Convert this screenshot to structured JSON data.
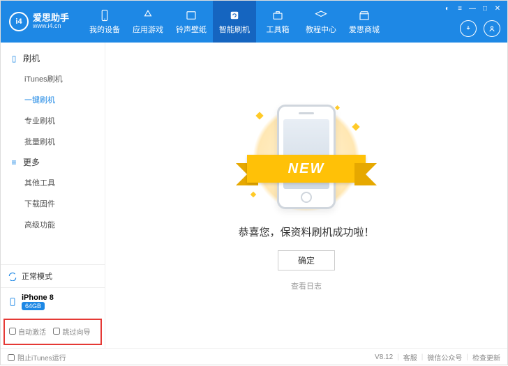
{
  "logo": {
    "badge": "i4",
    "title": "爱思助手",
    "sub": "www.i4.cn"
  },
  "nav": {
    "items": [
      {
        "label": "我的设备"
      },
      {
        "label": "应用游戏"
      },
      {
        "label": "铃声壁纸"
      },
      {
        "label": "智能刷机"
      },
      {
        "label": "工具箱"
      },
      {
        "label": "教程中心"
      },
      {
        "label": "爱思商城"
      }
    ]
  },
  "sidebar": {
    "group1_label": "刷机",
    "group1_items": [
      "iTunes刷机",
      "一键刷机",
      "专业刷机",
      "批量刷机"
    ],
    "group2_label": "更多",
    "group2_items": [
      "其他工具",
      "下载固件",
      "高级功能"
    ],
    "status_label": "正常模式",
    "device_name": "iPhone 8",
    "device_storage": "64GB",
    "auto_activate": "自动激活",
    "skip_wizard": "跳过向导"
  },
  "main": {
    "ribbon_text": "NEW",
    "success_text": "恭喜您，保资料刷机成功啦！",
    "ok_label": "确定",
    "log_label": "查看日志"
  },
  "footer": {
    "block_itunes": "阻止iTunes运行",
    "version": "V8.12",
    "support": "客服",
    "wechat": "微信公众号",
    "update": "检查更新"
  }
}
